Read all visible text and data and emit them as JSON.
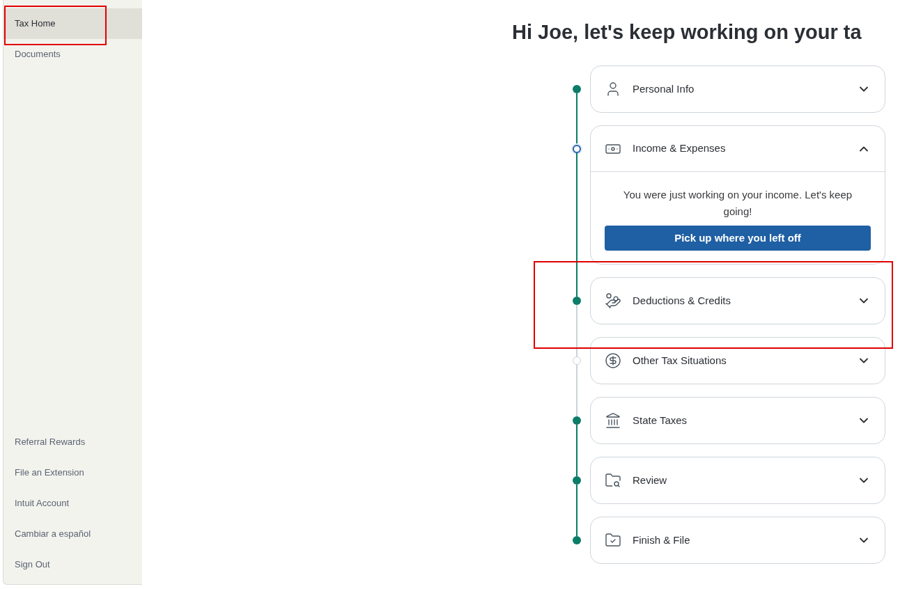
{
  "sidebar": {
    "top_items": [
      {
        "label": "Tax Home",
        "selected": true
      },
      {
        "label": "Documents",
        "selected": false
      }
    ],
    "bottom_items": [
      {
        "label": "Referral Rewards"
      },
      {
        "label": "File an Extension"
      },
      {
        "label": "Intuit Account"
      },
      {
        "label": "Cambiar a español"
      },
      {
        "label": "Sign Out"
      }
    ]
  },
  "heading": "Hi Joe, let's keep working on your ta",
  "steps": [
    {
      "title": "Personal Info",
      "completed": true,
      "current": false,
      "expanded": false
    },
    {
      "title": "Income & Expenses",
      "completed": false,
      "current": true,
      "expanded": true,
      "message": "You were just working on your income. Let's keep going!",
      "button": "Pick up where you left off"
    },
    {
      "title": "Deductions & Credits",
      "completed": true,
      "current": false,
      "expanded": false
    },
    {
      "title": "Other Tax Situations",
      "completed": false,
      "current": false,
      "expanded": false
    },
    {
      "title": "State Taxes",
      "completed": true,
      "current": false,
      "expanded": false
    },
    {
      "title": "Review",
      "completed": true,
      "current": false,
      "expanded": false
    },
    {
      "title": "Finish & File",
      "completed": true,
      "current": false,
      "expanded": false
    }
  ]
}
